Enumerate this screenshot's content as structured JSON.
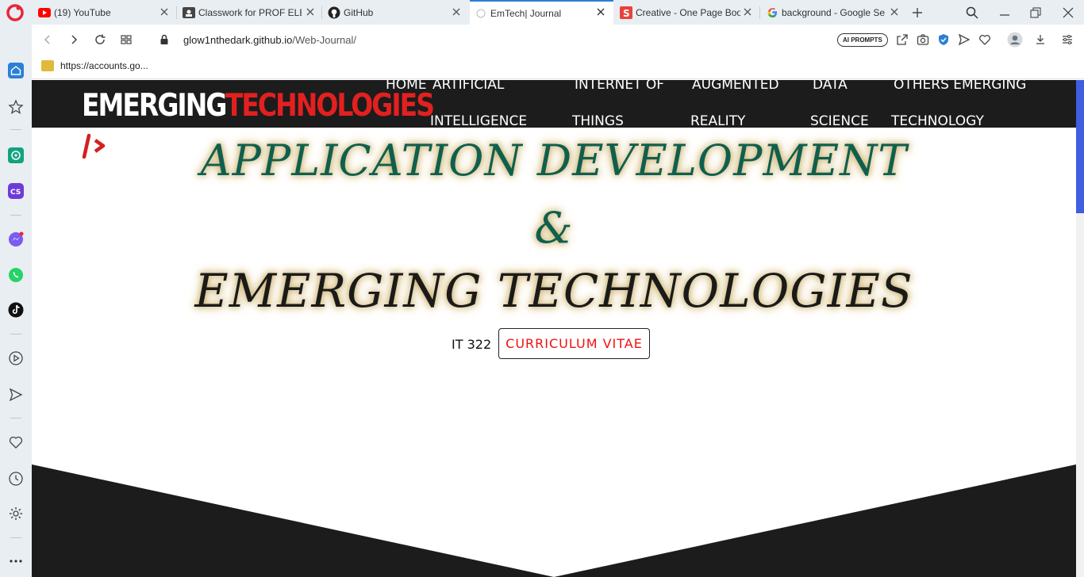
{
  "browser": {
    "tabs": [
      {
        "title": "(19) YouTube"
      },
      {
        "title": "Classwork for PROF ELEC"
      },
      {
        "title": "GitHub"
      },
      {
        "title": "EmTech| Journal"
      },
      {
        "title": "Creative - One Page Boo"
      },
      {
        "title": "background - Google Se"
      }
    ],
    "active_tab": 3,
    "url_host": "glow1nthedark.github.io",
    "url_path": "/Web-Journal/",
    "ai_prompts_label": "AI PROMPTS",
    "bookmark": "https://accounts.go..."
  },
  "site": {
    "brand_part1": "EMERGING",
    "brand_part2": "TECHNOLOGIES",
    "nav": [
      {
        "line1": "HOME",
        "line2": ""
      },
      {
        "line1": "ARTIFICIAL",
        "line2": "INTELLIGENCE"
      },
      {
        "line1": "INTERNET OF",
        "line2": "THINGS"
      },
      {
        "line1": "AUGMENTED",
        "line2": "REALITY"
      },
      {
        "line1": "DATA",
        "line2": "SCIENCE"
      },
      {
        "line1": "OTHERS EMERGING",
        "line2": "TECHNOLOGY"
      }
    ],
    "headline1": "APPLICATION DEVELOPMENT",
    "ampersand": "&",
    "headline2": "EMERGING TECHNOLOGIES",
    "course_code": "IT 322",
    "cv_button": "CURRICULUM VITAE"
  },
  "colors": {
    "accent_red": "#e32020",
    "headline_green": "#0f5f4e",
    "header_dark": "#1c1c1c",
    "tab_accent": "#2b7fd8"
  }
}
